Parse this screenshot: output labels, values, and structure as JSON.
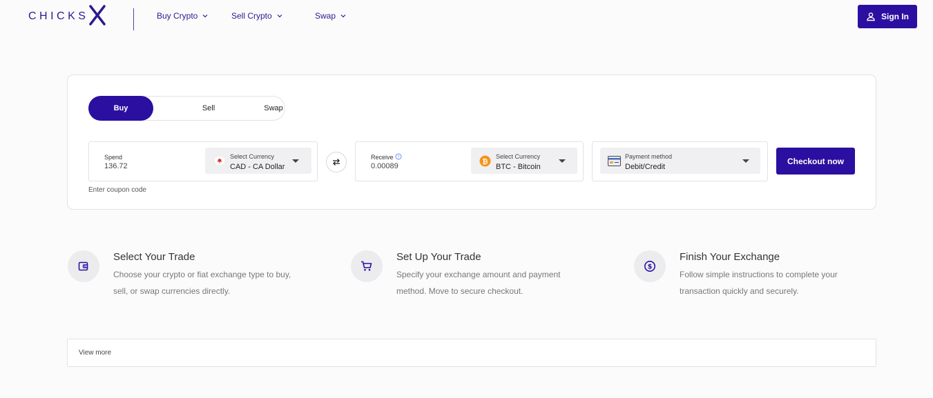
{
  "header": {
    "logo": "CHICKS",
    "logo_mark": "X",
    "nav": [
      {
        "label": "Buy Crypto"
      },
      {
        "label": "Sell Crypto"
      },
      {
        "label": "Swap"
      }
    ],
    "signin_label": "Sign In"
  },
  "trade": {
    "tabs": [
      "Buy",
      "Sell",
      "Swap"
    ],
    "active_tab": "Buy",
    "spend": {
      "label": "Spend",
      "value": "136.72",
      "currency_label": "Select Currency",
      "currency_value": "CAD - CA Dollar",
      "icon": "canada-flag-icon"
    },
    "receive": {
      "label": "Receive",
      "value": "0.00089",
      "currency_label": "Select Currency",
      "currency_value": "BTC - Bitcoin",
      "icon": "bitcoin-icon"
    },
    "payment": {
      "label": "Payment method",
      "value": "Debit/Credit",
      "icon": "credit-card-icon"
    },
    "checkout_label": "Checkout now",
    "coupon_label": "Enter coupon code"
  },
  "steps": [
    {
      "title": "Select Your Trade",
      "desc": "Choose your crypto or fiat exchange type to buy, sell, or swap currencies directly.",
      "icon": "wallet-icon"
    },
    {
      "title": "Set Up Your Trade",
      "desc": "Specify your exchange amount and payment method. Move to secure checkout.",
      "icon": "cart-icon"
    },
    {
      "title": "Finish Your Exchange",
      "desc": "Follow simple instructions to complete your transaction quickly and securely.",
      "icon": "dollar-coin-icon"
    }
  ],
  "view_more_label": "View more",
  "colors": {
    "primary": "#2b0fa0",
    "bitcoin": "#f7931a",
    "canada_red": "#d52b1e"
  }
}
